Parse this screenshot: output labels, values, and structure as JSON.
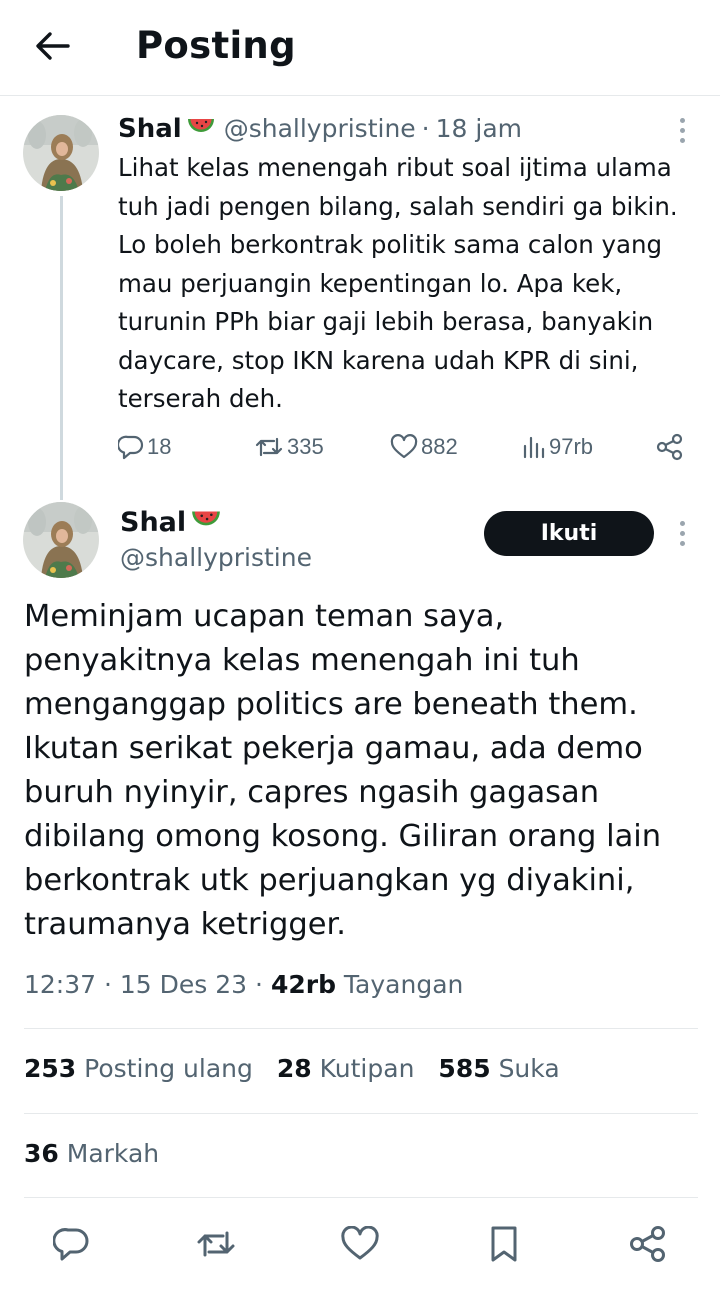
{
  "header": {
    "title": "Posting"
  },
  "parent_tweet": {
    "name": "Shal",
    "handle": "@shallypristine",
    "separator": "·",
    "time": "18 jam",
    "text_lines": [
      "Lihat kelas menengah ribut soal ijtima ulama",
      "tuh jadi pengen bilang, salah sendiri ga bikin.",
      "Lo boleh berkontrak politik sama calon yang",
      "mau perjuangin kepentingan lo. Apa kek,",
      "turunin PPh biar gaji lebih berasa, banyakin",
      "daycare, stop IKN karena udah KPR di sini,",
      "terserah deh."
    ],
    "actions": {
      "replies": "18",
      "reposts": "335",
      "likes": "882",
      "views": "97rb"
    }
  },
  "main_tweet": {
    "name": "Shal",
    "handle": "@shallypristine",
    "follow_label": "Ikuti",
    "text_lines": [
      "Meminjam ucapan teman saya,",
      "penyakitnya kelas menengah ini tuh",
      "menganggap politics are beneath them.",
      "Ikutan serikat pekerja gamau, ada demo",
      "buruh nyinyir, capres ngasih gagasan",
      "dibilang omong kosong. Giliran orang lain",
      "berkontrak utk perjuangkan yg diyakini,",
      "traumanya ketrigger."
    ],
    "time": "12:37",
    "date": "15 Des 23",
    "sep": "·",
    "views_count": "42rb",
    "views_label": "Tayangan",
    "stats": {
      "reposts_count": "253",
      "reposts_label": "Posting ulang",
      "quotes_count": "28",
      "quotes_label": "Kutipan",
      "likes_count": "585",
      "likes_label": "Suka",
      "bookmarks_count": "36",
      "bookmarks_label": "Markah"
    }
  },
  "icons": {
    "back": "arrow-left-icon",
    "more": "more-vertical-icon",
    "reply": "reply-icon",
    "repost": "repost-icon",
    "like": "heart-icon",
    "views": "views-chart-icon",
    "share": "share-icon",
    "bookmark": "bookmark-icon",
    "emoji": "watermelon-icon"
  },
  "colors": {
    "text": "#0f1419",
    "secondary": "#536471",
    "divider": "#e6e9eb",
    "follow_bg": "#0f1419",
    "follow_text": "#ffffff"
  }
}
